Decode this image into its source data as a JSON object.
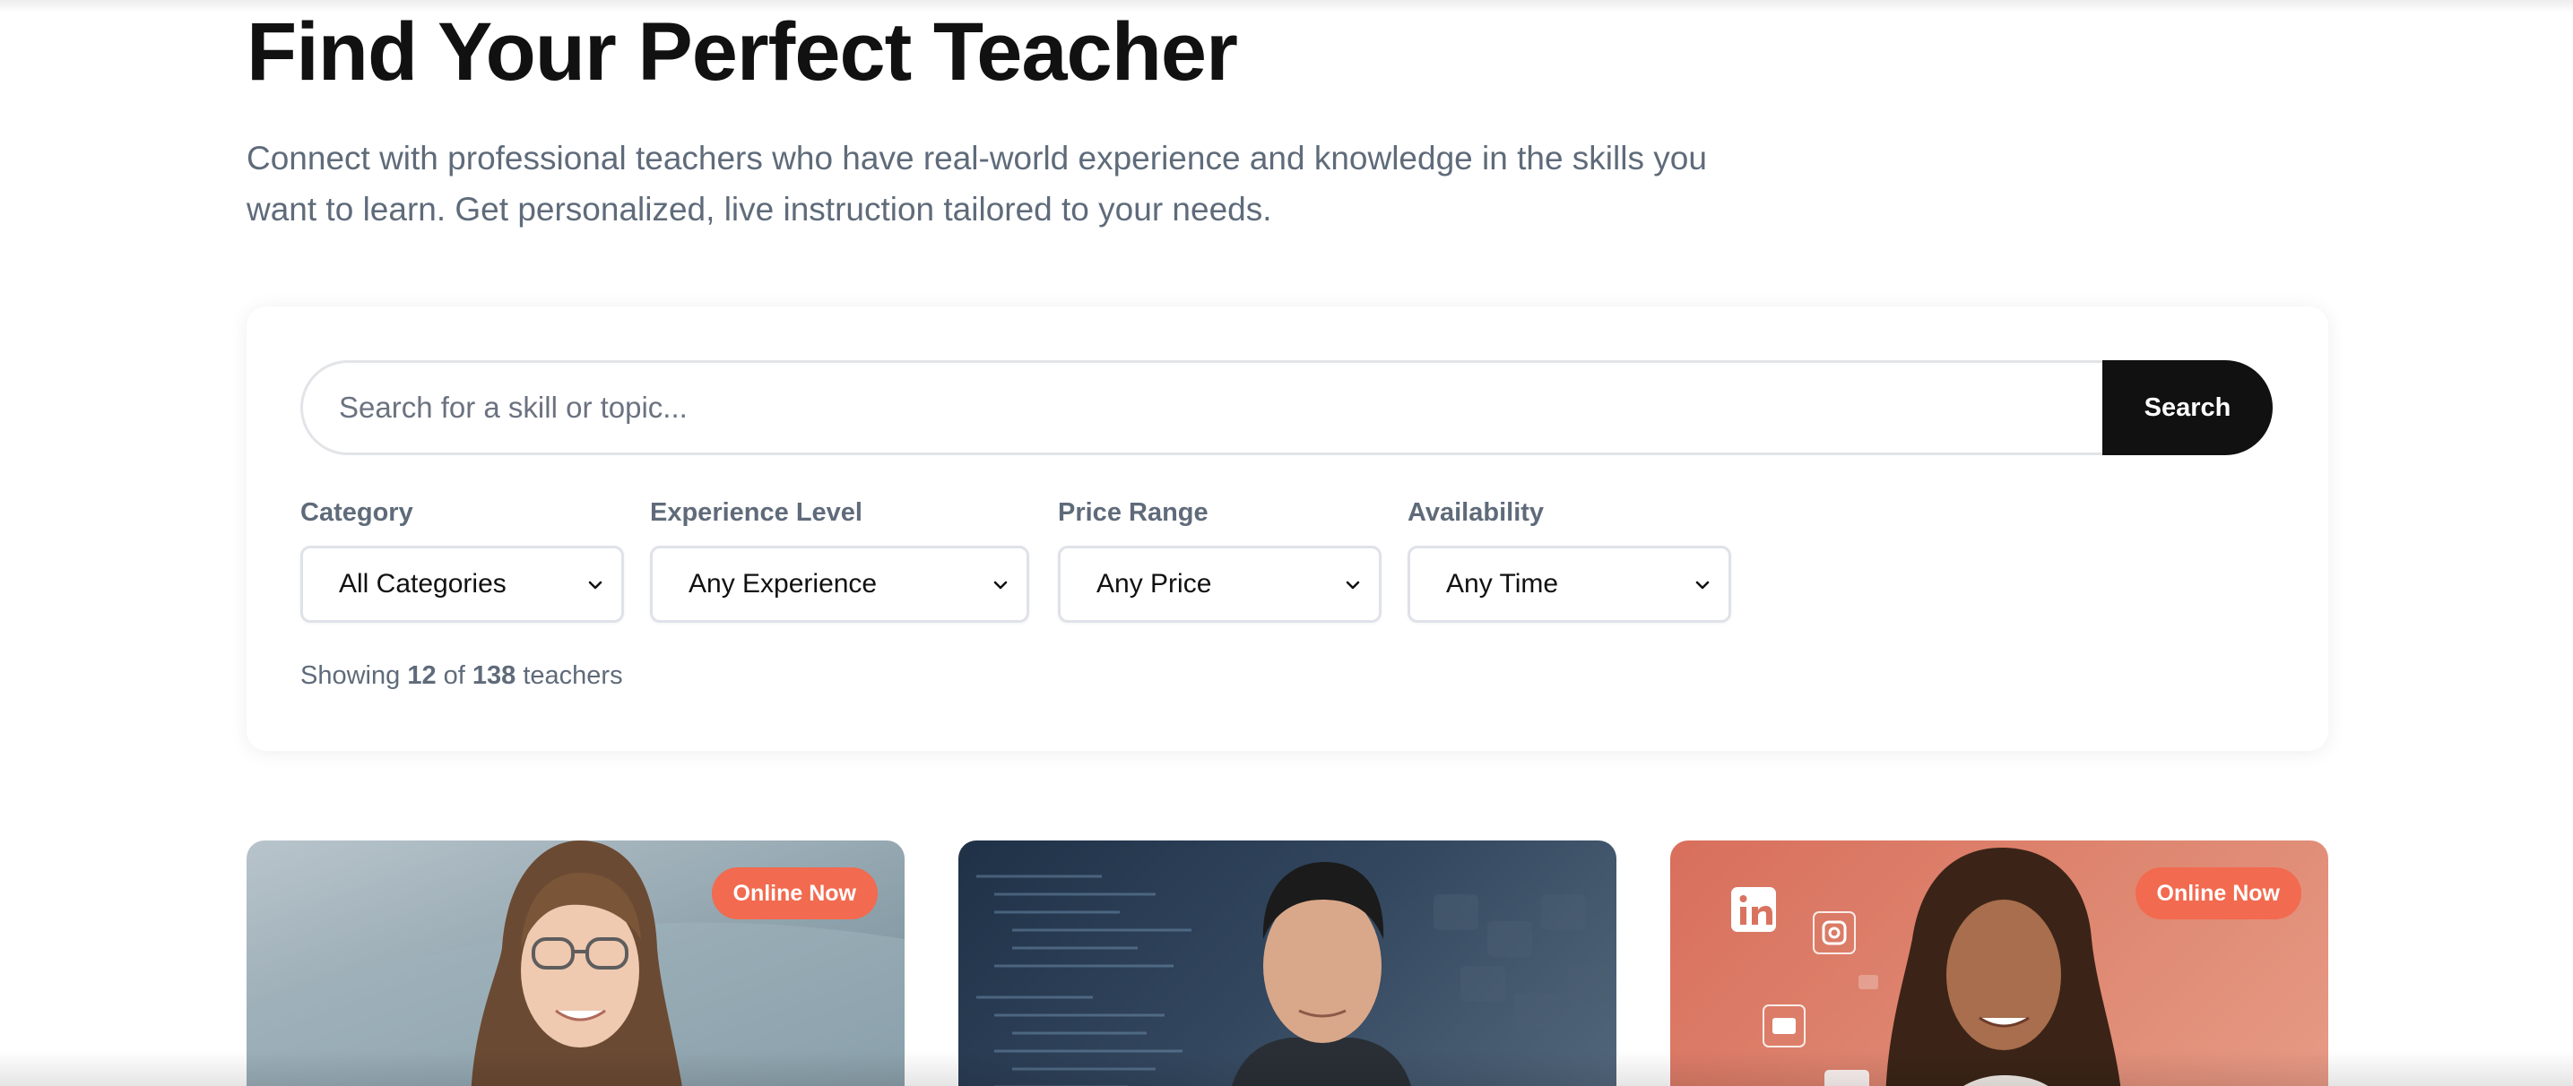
{
  "header": {
    "title": "Find Your Perfect Teacher",
    "subtitle": "Connect with professional teachers who have real-world experience and knowledge in the skills you want to learn. Get personalized, live instruction tailored to your needs."
  },
  "search": {
    "placeholder": "Search for a skill or topic...",
    "value": "",
    "button_label": "Search"
  },
  "filters": {
    "category": {
      "label": "Category",
      "selected": "All Categories"
    },
    "experience": {
      "label": "Experience Level",
      "selected": "Any Experience"
    },
    "price": {
      "label": "Price Range",
      "selected": "Any Price"
    },
    "availability": {
      "label": "Availability",
      "selected": "Any Time"
    }
  },
  "results": {
    "prefix": "Showing",
    "shown": "12",
    "of_word": "of",
    "total": "138",
    "suffix": "teachers"
  },
  "teachers": [
    {
      "badge": "Online Now"
    },
    {
      "badge": ""
    },
    {
      "badge": "Online Now"
    }
  ],
  "colors": {
    "primary_button": "#111111",
    "badge_online": "#f26a4f",
    "muted_text": "#5f6b7a"
  },
  "icons": {
    "select_chevron": "chevron-down-icon",
    "card_3_social": [
      "linkedin-icon",
      "instagram-icon",
      "folder-icon",
      "id-card-icon"
    ]
  }
}
